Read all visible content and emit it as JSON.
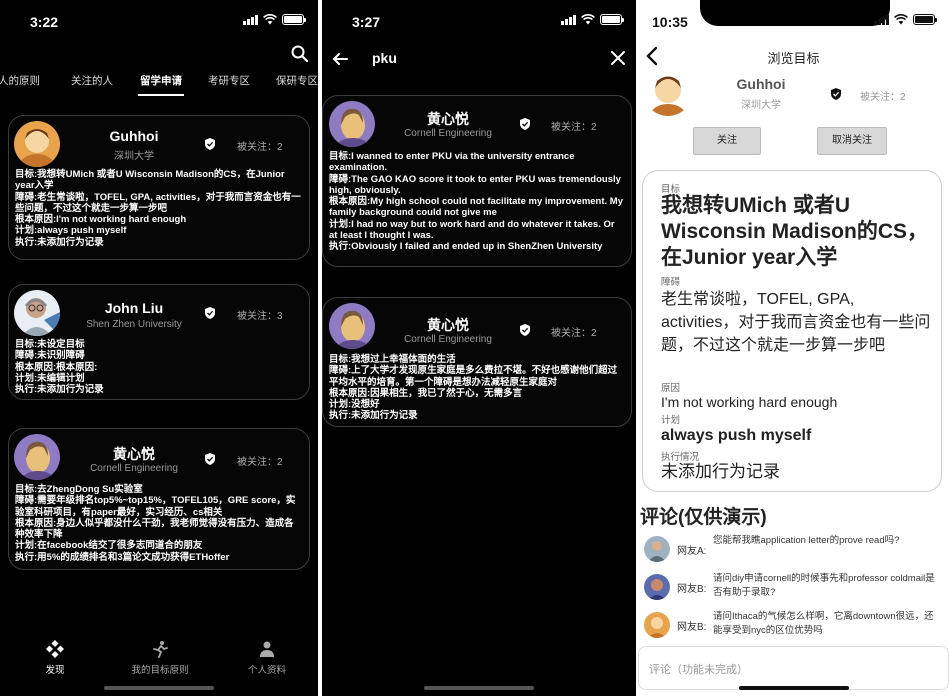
{
  "phone1": {
    "time": "3:22",
    "tabs": [
      "人的原则",
      "关注的人",
      "留学申请",
      "考研专区",
      "保研专区"
    ],
    "active_tab": "留学申请",
    "cards": [
      {
        "name": "Guhhoi",
        "school": "深圳大学",
        "followers": "被关注：2",
        "lines": [
          "目标:我想转UMich 或者U Wisconsin Madison的CS，在Junior year入学",
          "障碍:老生常谈啦，TOFEL, GPA, activities，对于我而言资金也有一些问题，不过这个就走一步算一步吧",
          "根本原因:I'm not working hard enough",
          "计划:always push myself",
          "执行:未添加行为记录"
        ]
      },
      {
        "name": "John Liu",
        "school": "Shen Zhen University",
        "followers": "被关注：3",
        "lines": [
          "目标:未设定目标",
          "障碍:未识别障碍",
          "根本原因:根本原因:",
          "计划:未编辑计划",
          "执行:未添加行为记录"
        ]
      },
      {
        "name": "黄心悦",
        "school": "Cornell Engineering",
        "followers": "被关注：2",
        "lines": [
          "目标:去ZhengDong Su实验室",
          "障碍:需要年级排名top5%~top15%，TOFEL105，GRE score，实验室科研项目，有paper最好，实习经历、cs相关",
          "根本原因:身边人似乎都没什么干劲，我老师觉得没有压力、造成各种效率下降",
          "计划:在facebook结交了很多志同道合的朋友",
          "执行:用5%的成绩排名和3篇论文成功获得ETHoffer"
        ]
      }
    ],
    "nav": [
      {
        "label": "发现",
        "icon": "discover-icon"
      },
      {
        "label": "我的目标原则",
        "icon": "runner-icon"
      },
      {
        "label": "个人资料",
        "icon": "person-icon"
      }
    ]
  },
  "phone2": {
    "time": "3:27",
    "query": "pku",
    "cards": [
      {
        "name": "黄心悦",
        "school": "Cornell Engineering",
        "followers": "被关注：2",
        "lines": [
          "目标:I wanned to enter PKU via the university entrance examination.",
          "障碍:The GAO KAO score it took to enter PKU was tremendously high, obviously.",
          "根本原因:My high school could not facilitate my improvement. My family background could not give me",
          "计划:I had no way but to work hard and do whatever it takes. Or at least I thought I was.",
          "执行:Obviously I failed and ended up in ShenZhen University"
        ]
      },
      {
        "name": "黄心悦",
        "school": "Cornell Engineering",
        "followers": "被关注：2",
        "lines": [
          "目标:我想过上幸福体面的生活",
          "障碍:上了大学才发现原生家庭是多么费拉不堪。不好也感谢他们超过平均水平的培育。第一个障碍是想办法减轻原生家庭对",
          "根本原因:因果相生，我已了然于心，无需多言",
          "计划:没想好",
          "执行:未添加行为记录"
        ]
      }
    ]
  },
  "phone3": {
    "time": "10:35",
    "title": "浏览目标",
    "profile": {
      "name": "Guhhoi",
      "school": "深圳大学",
      "followers": "被关注：2"
    },
    "follow_label": "关注",
    "unfollow_label": "取消关注",
    "goal": {
      "goal_label": "目标",
      "goal_text": "我想转UMich 或者U Wisconsin Madison的CS，在Junior year入学",
      "obstacle_label": "障碍",
      "obstacle_text": "老生常谈啦，TOFEL, GPA, activities，对于我而言资金也有一些问题，不过这个就走一步算一步吧",
      "cause_label": "原因",
      "cause_text": "I'm not working hard enough",
      "plan_label": "计划",
      "plan_text": "always push myself",
      "exec_label": "执行情况",
      "exec_text": "未添加行为记录"
    },
    "comments_title": "评论(仅供演示)",
    "comments": [
      {
        "user": "网友A:",
        "text": "您能帮我瞧application letter的prove read吗?"
      },
      {
        "user": "网友B:",
        "text": "请问diy申请cornell的时候事先和professor coldmail是否有助于录取?"
      },
      {
        "user": "网友B:",
        "text": "请问Ithaca的气候怎么样啊，它离downtown很远，还能享受到nyc的区位优势吗"
      }
    ],
    "comment_placeholder": "评论（功能未完成）"
  },
  "colors": {
    "dark_bg": "#000000",
    "card_border": "#3c3c3c",
    "light_bg": "#ffffff",
    "button_gray": "#d8d8d8"
  }
}
